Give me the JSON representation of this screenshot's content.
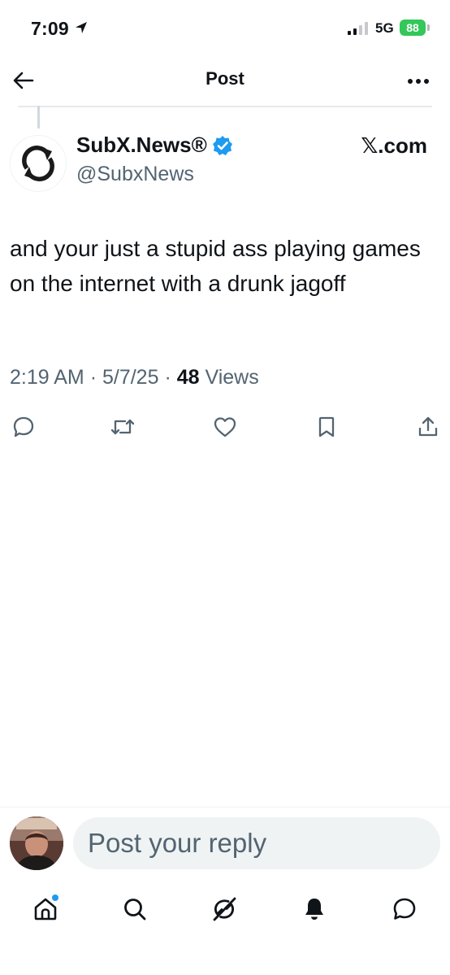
{
  "status_bar": {
    "time": "7:09",
    "network": "5G",
    "battery": "88"
  },
  "header": {
    "title": "Post"
  },
  "post": {
    "author_name": "SubX.News®",
    "author_handle": "@SubxNews",
    "source": "𝕏.com",
    "text": "and your just a stupid ass playing games on the internet with a drunk jagoff",
    "time": "2:19 AM",
    "separator": "·",
    "date": "5/7/25",
    "views_count": "48",
    "views_label": "Views"
  },
  "reply": {
    "placeholder": "Post your reply"
  },
  "colors": {
    "accent": "#1d9bf0",
    "text_primary": "#0f1419",
    "text_secondary": "#536471",
    "battery": "#34c759"
  },
  "icons": {
    "actions": [
      "reply-icon",
      "repost-icon",
      "like-icon",
      "bookmark-icon",
      "share-icon"
    ],
    "tabs": [
      "home-icon",
      "search-icon",
      "grok-icon",
      "notifications-icon",
      "messages-icon"
    ]
  }
}
